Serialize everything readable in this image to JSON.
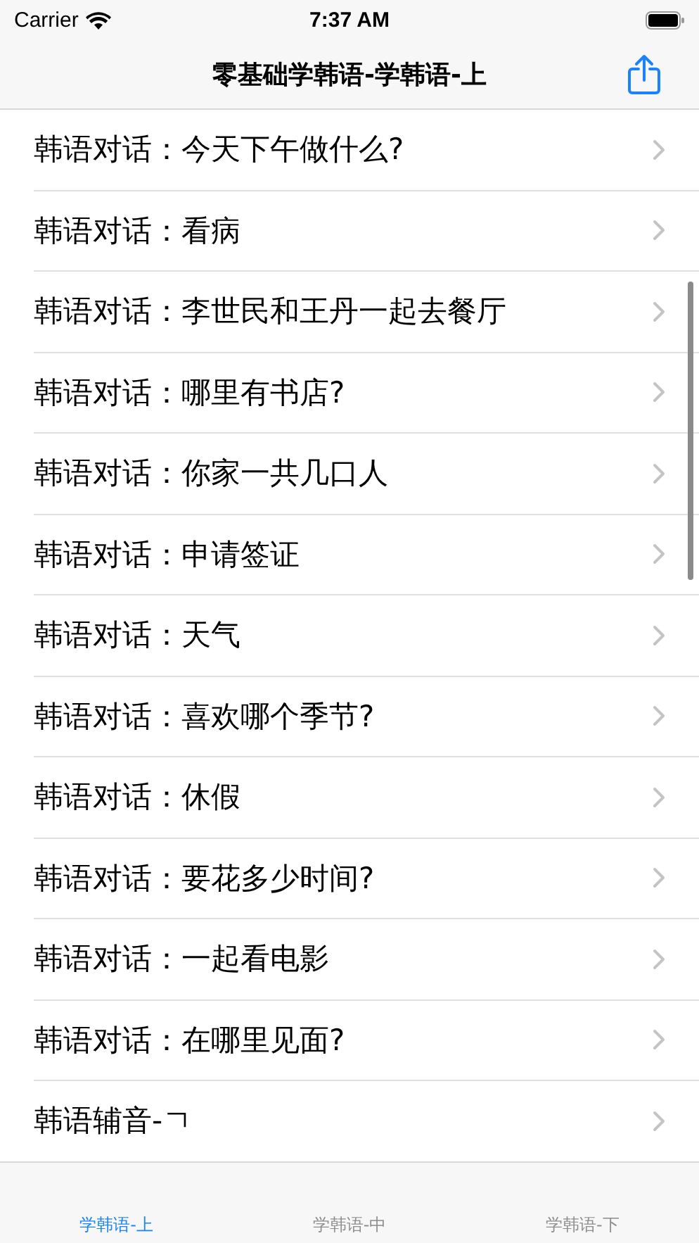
{
  "status_bar": {
    "carrier": "Carrier",
    "time": "7:37 AM"
  },
  "nav": {
    "title": "零基础学韩语-学韩语-上"
  },
  "rows": [
    {
      "label": "韩语对话：今天下午做什么?"
    },
    {
      "label": "韩语对话：看病"
    },
    {
      "label": "韩语对话：李世民和王丹一起去餐厅"
    },
    {
      "label": "韩语对话：哪里有书店?"
    },
    {
      "label": "韩语对话：你家一共几口人"
    },
    {
      "label": "韩语对话：申请签证"
    },
    {
      "label": "韩语对话：天气"
    },
    {
      "label": "韩语对话：喜欢哪个季节?"
    },
    {
      "label": "韩语对话：休假"
    },
    {
      "label": "韩语对话：要花多少时间?"
    },
    {
      "label": "韩语对话：一起看电影"
    },
    {
      "label": "韩语对话：在哪里见面?"
    },
    {
      "label": "韩语辅音-ㄱ"
    }
  ],
  "tabs": [
    {
      "label": "学韩语-上",
      "selected": true
    },
    {
      "label": "学韩语-中",
      "selected": false
    },
    {
      "label": "学韩语-下",
      "selected": false
    }
  ]
}
